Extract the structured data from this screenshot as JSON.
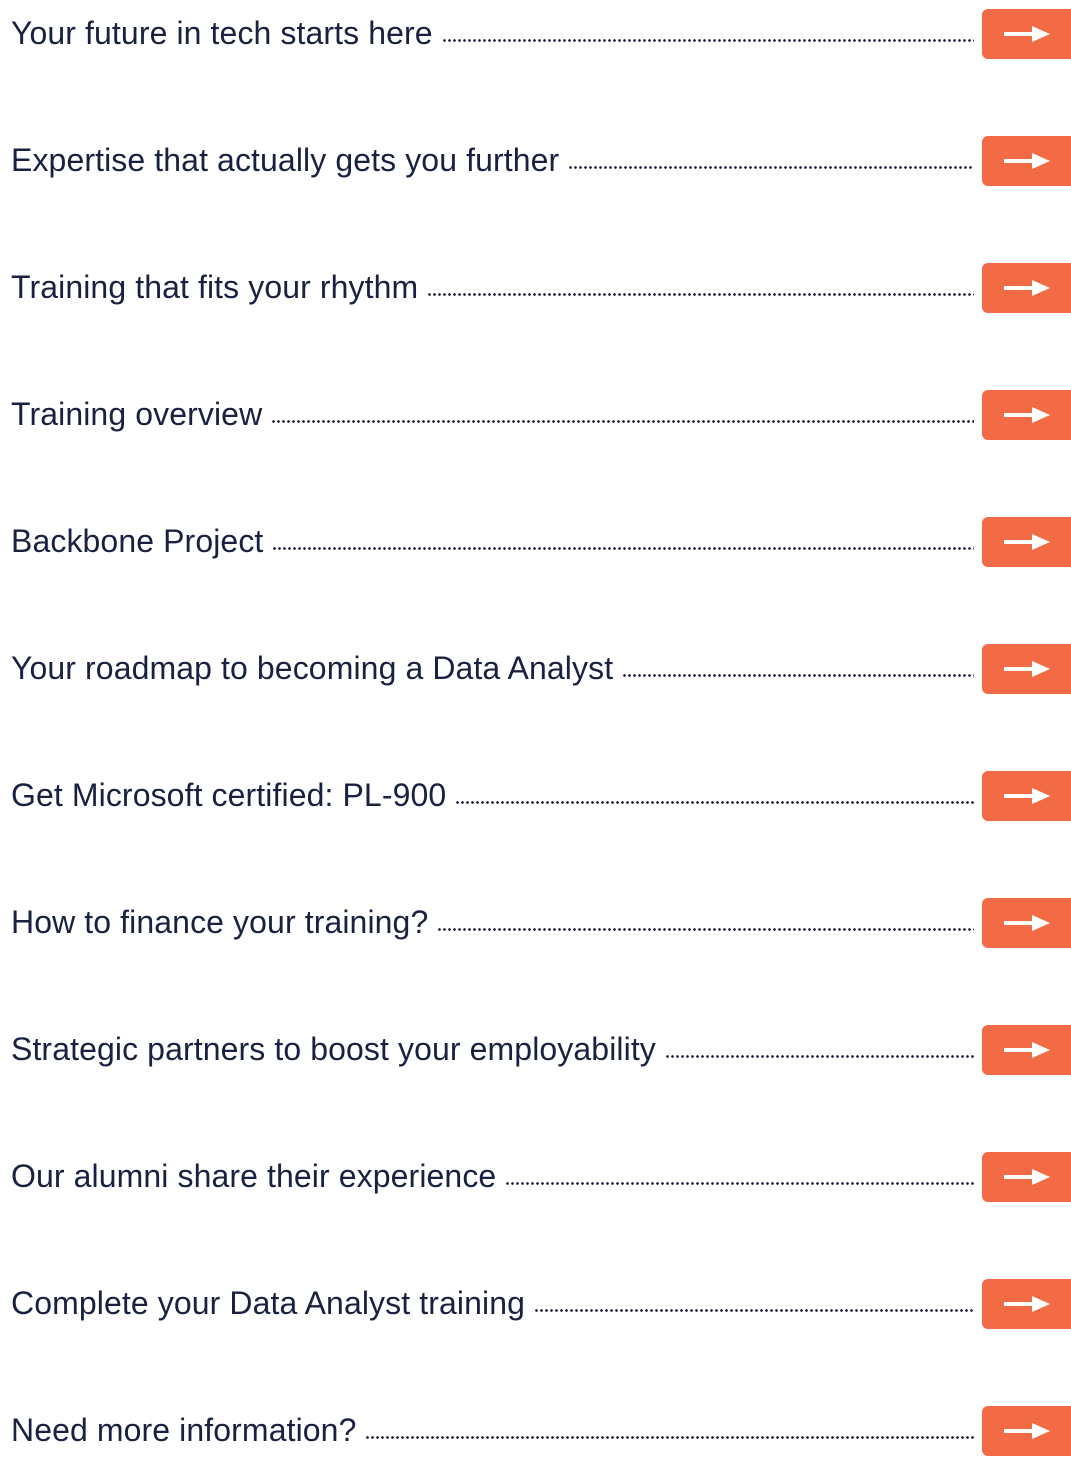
{
  "colors": {
    "text": "#1a2140",
    "accent": "#f26b45",
    "background": "#ffffff"
  },
  "icons": {
    "arrow": "arrow-right-icon"
  },
  "toc": {
    "items": [
      {
        "label": "Your future in tech starts here"
      },
      {
        "label": "Expertise that actually gets you further"
      },
      {
        "label": "Training that fits your rhythm"
      },
      {
        "label": "Training overview"
      },
      {
        "label": "Backbone Project"
      },
      {
        "label": "Your roadmap to becoming a Data Analyst"
      },
      {
        "label": "Get Microsoft certified: PL-900"
      },
      {
        "label": "How to finance your training?"
      },
      {
        "label": "Strategic partners to boost your employability"
      },
      {
        "label": "Our alumni share their experience"
      },
      {
        "label": "Complete your Data Analyst training"
      },
      {
        "label": "Need more information?"
      }
    ]
  }
}
